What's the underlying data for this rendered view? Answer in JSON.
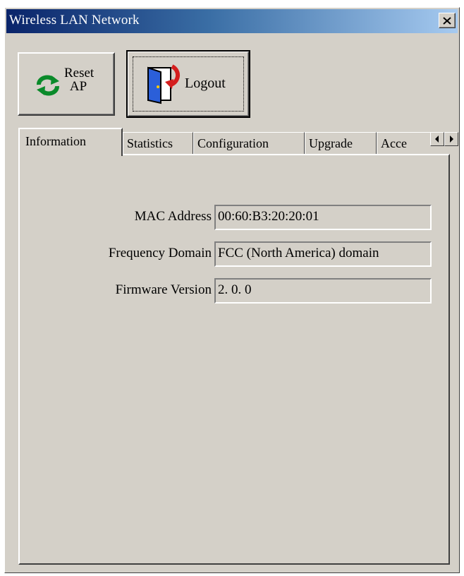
{
  "window": {
    "title": "Wireless LAN Network"
  },
  "toolbar": {
    "reset_label": "Reset\nAP",
    "logout_label": "Logout"
  },
  "tabs": [
    {
      "label": "Information",
      "active": true
    },
    {
      "label": "Statistics",
      "active": false
    },
    {
      "label": "Configuration",
      "active": false
    },
    {
      "label": "Upgrade",
      "active": false
    },
    {
      "label": "Acce",
      "active": false
    }
  ],
  "info": {
    "mac_label": "MAC Address :",
    "mac_value": "00:60:B3:20:20:01",
    "freq_label": "Frequency Domain :",
    "freq_value": "FCC (North America) domain",
    "fw_label": "Firmware Version :",
    "fw_value": "2. 0. 0"
  },
  "icons": {
    "close": "close-icon",
    "reset": "refresh-icon",
    "logout": "door-exit-icon",
    "tab_left": "arrow-left-icon",
    "tab_right": "arrow-right-icon"
  },
  "colors": {
    "face": "#d4d0c8",
    "title_start": "#0a246a",
    "title_end": "#a6caf0"
  }
}
